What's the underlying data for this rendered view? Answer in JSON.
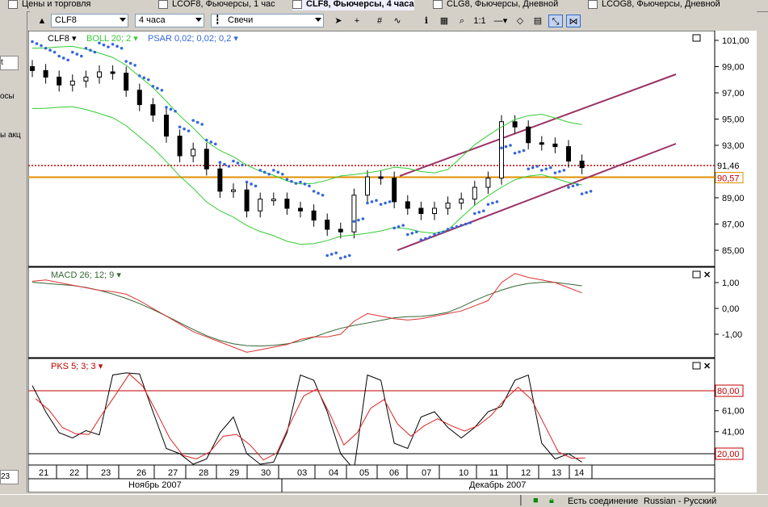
{
  "tabs": [
    {
      "label": "Цены и торговля",
      "active": false
    },
    {
      "label": "LCOF8, Фьючерсы, 1 час",
      "active": false
    },
    {
      "label": "CLF8, Фьючерсы, 4 часа",
      "active": true
    },
    {
      "label": "CLG8, Фьючерсы, Дневной",
      "active": false
    },
    {
      "label": "LCOG8, Фьючерсы, Дневной",
      "active": false
    }
  ],
  "left_panel": {
    "items": [
      "t",
      "осы",
      "ы акц",
      "23"
    ]
  },
  "toolbar": {
    "symbol": "CLF8",
    "period": "4 часа",
    "chart_type": "Свечи",
    "zoom_label": "1:1"
  },
  "legend": {
    "symbol": "CLF8",
    "boll": "BOLL 20; 2",
    "psar": "PSAR 0,02; 0,02; 0,2"
  },
  "price_axis": {
    "ticks": [
      "101,00",
      "99,00",
      "97,00",
      "95,00",
      "93,00",
      "91,46",
      "90,57",
      "89,00",
      "87,00",
      "85,00"
    ]
  },
  "macd": {
    "label": "MACD 26; 12; 9",
    "ticks": [
      "1,00",
      "0,00",
      "-1,00"
    ]
  },
  "pks": {
    "label": "PKS 5; 3; 3",
    "ticks": [
      "80,00",
      "61,00",
      "41,00",
      "20,00"
    ]
  },
  "time_axis": {
    "days": [
      "21",
      "22",
      "23",
      "26",
      "27",
      "28",
      "29",
      "30",
      "03",
      "04",
      "05",
      "06",
      "07",
      "10",
      "11",
      "12",
      "13",
      "14"
    ],
    "months": [
      "Ноябрь 2007",
      "Декабрь 2007"
    ]
  },
  "status": {
    "connection": "Есть соединение",
    "language": "Russian - Русский"
  },
  "colors": {
    "price_line": "#c00000",
    "support_line": "#e09000",
    "boll": "#33cc33",
    "psar": "#3366dd",
    "channel": "#993366",
    "macd_signal": "#336633",
    "macd_line": "#dd3333",
    "pks_k": "#000000",
    "pks_d": "#dd2222"
  },
  "chart_data": {
    "type": "candlestick",
    "series_close": [
      98.7,
      98.2,
      97.6,
      97.9,
      98.2,
      98.6,
      98.5,
      97.2,
      96.1,
      95.3,
      93.7,
      92.2,
      92.7,
      91.2,
      89.5,
      89.6,
      88.0,
      88.9,
      88.9,
      88.2,
      88.0,
      87.3,
      86.6,
      86.4,
      89.2,
      90.6,
      90.5,
      88.7,
      88.2,
      87.8,
      88.2,
      88.6,
      88.9,
      89.8,
      90.5,
      94.8,
      94.4,
      93.2,
      93.1,
      92.9,
      91.8,
      91.3
    ],
    "last_price": 91.46,
    "support_level": 90.57,
    "ylim": [
      84.5,
      101.5
    ]
  }
}
